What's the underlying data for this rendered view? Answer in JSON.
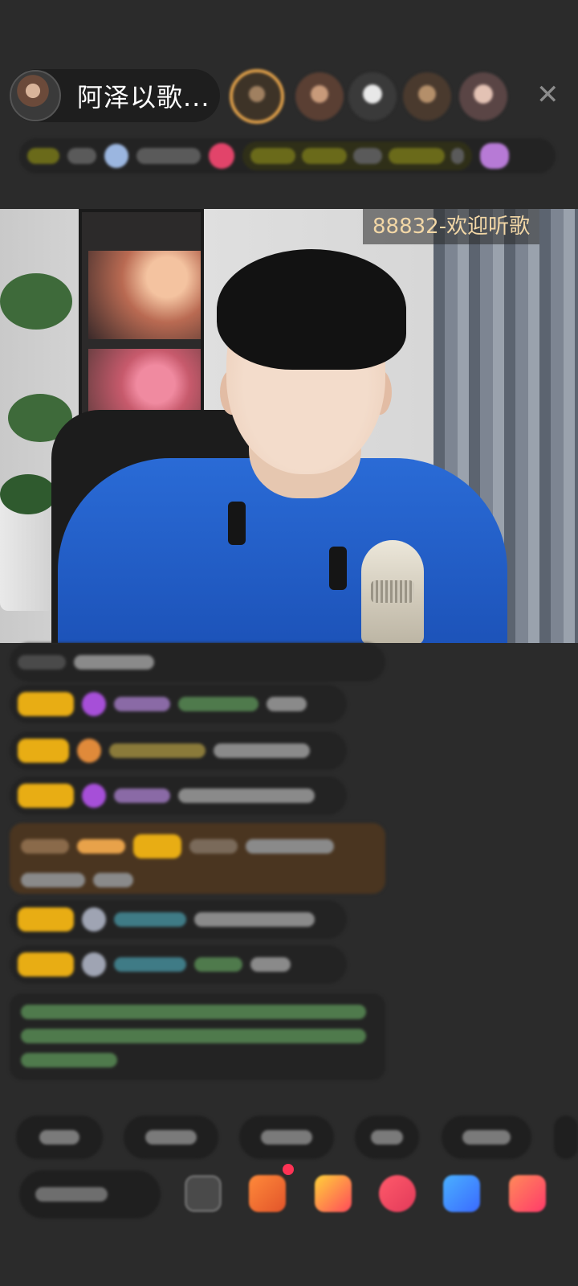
{
  "host": {
    "name": "阿泽以歌..."
  },
  "video": {
    "room_tag": "88832-欢迎听歌"
  },
  "icons": {
    "close": "close-icon",
    "gift": "gift-icon",
    "share": "share-icon"
  },
  "colors": {
    "background": "#2b2b2b",
    "room_tag_text": "#f2d7a6",
    "badge_gold": "#e8ad14"
  }
}
